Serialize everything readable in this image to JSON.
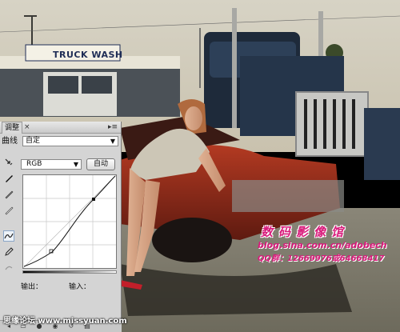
{
  "photo": {
    "sign_text": "TRUCK WASH",
    "watermark_title": "数码影像馆",
    "watermark_blog": "blog.sina.com.cn/adobech",
    "watermark_qq": "QQ群：12669976或64668417"
  },
  "panel": {
    "tab_label": "调整",
    "close_glyph": "×",
    "menu_glyph": "▸≡",
    "curve_label": "曲线",
    "preset_value": "自定",
    "channel_value": "RGB",
    "auto_label": "自动",
    "output_label": "输出：",
    "input_label": "输入："
  },
  "footer": {
    "forum_text": "思缘论坛  www.missyuan.com"
  },
  "icons": [
    "target-adjust-icon",
    "eyedropper-black-icon",
    "eyedropper-gray-icon",
    "eyedropper-white-icon",
    "curve-point-icon",
    "pencil-draw-icon",
    "smooth-icon"
  ]
}
